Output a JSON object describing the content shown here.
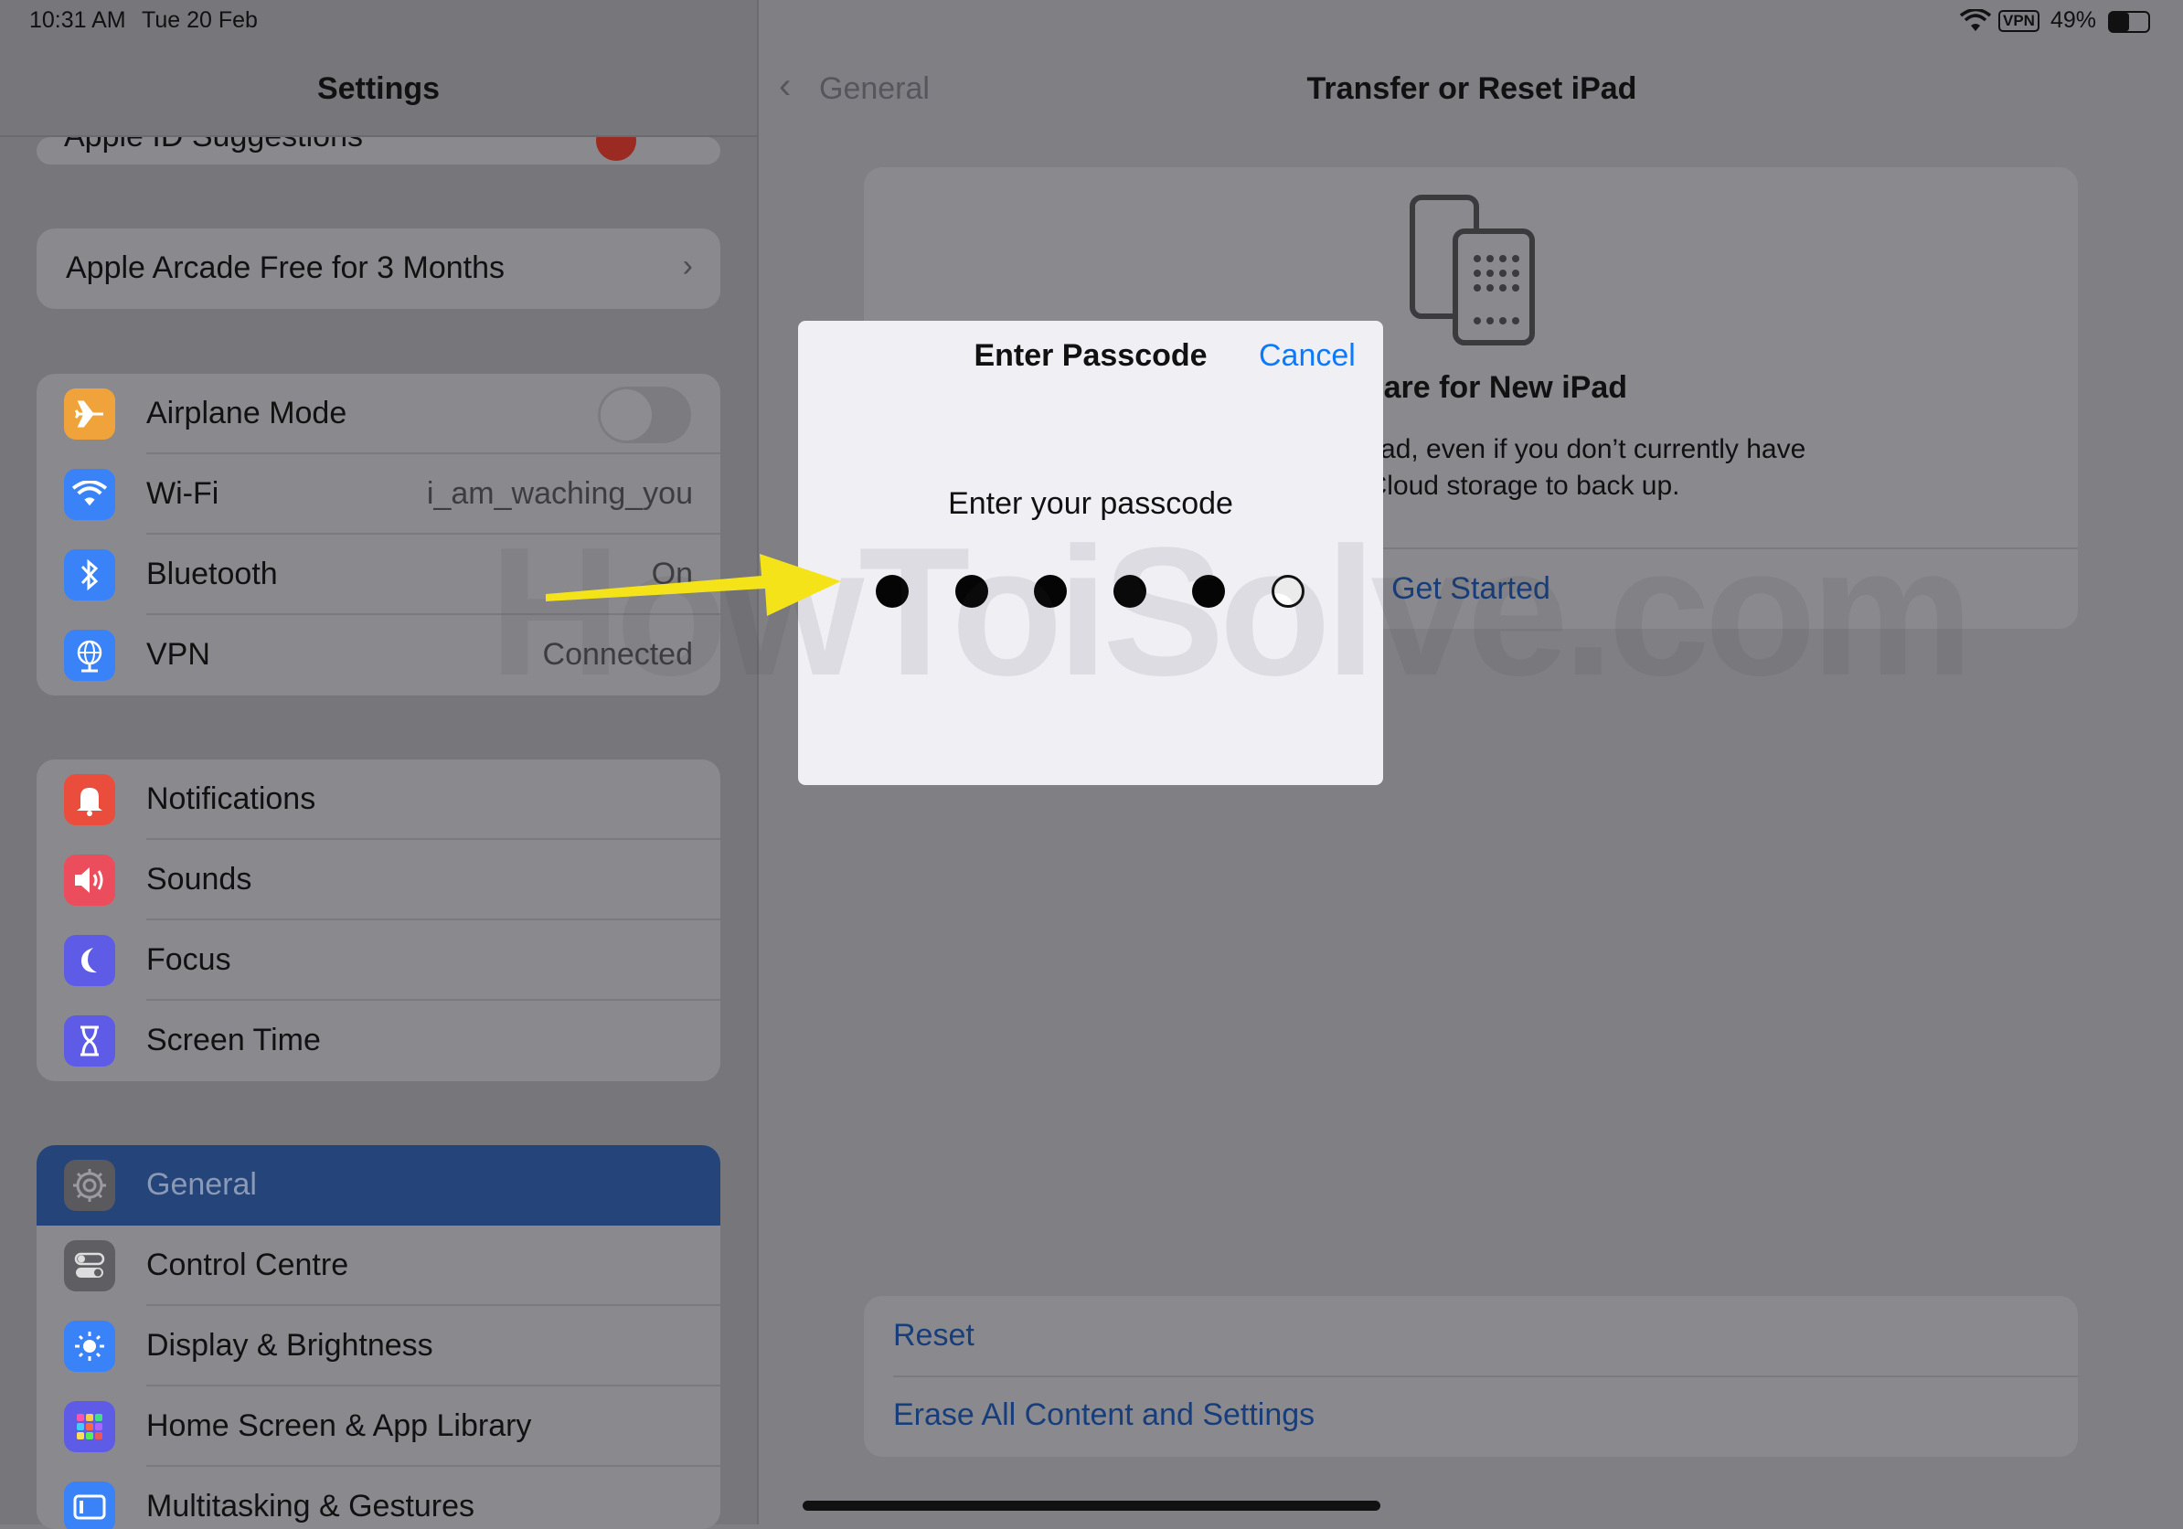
{
  "status_bar": {
    "time": "10:31 AM",
    "date": "Tue 20 Feb",
    "vpn": "VPN",
    "battery": "49%"
  },
  "sidebar": {
    "title": "Settings",
    "partial_top_item": "Apple ID Suggestions",
    "promo": "Apple Arcade Free for 3 Months",
    "connectivity": [
      {
        "label": "Airplane Mode",
        "value": "",
        "icon": "airplane-icon",
        "color": "#f0a33a"
      },
      {
        "label": "Wi-Fi",
        "value": "i_am_waching_you",
        "icon": "wifi-icon",
        "color": "#3a82f7"
      },
      {
        "label": "Bluetooth",
        "value": "On",
        "icon": "bluetooth-icon",
        "color": "#3a82f7"
      },
      {
        "label": "VPN",
        "value": "Connected",
        "icon": "vpn-globe-icon",
        "color": "#3a82f7"
      }
    ],
    "notifications_group": [
      {
        "label": "Notifications",
        "icon": "bell-icon",
        "color": "#eb4d3d"
      },
      {
        "label": "Sounds",
        "icon": "speaker-icon",
        "color": "#eb4d5d"
      },
      {
        "label": "Focus",
        "icon": "moon-icon",
        "color": "#5e5ce6"
      },
      {
        "label": "Screen Time",
        "icon": "hourglass-icon",
        "color": "#5e5ce6"
      }
    ],
    "general_group": [
      {
        "label": "General",
        "icon": "gear-icon",
        "color": "#8e8e93",
        "selected": true
      },
      {
        "label": "Control Centre",
        "icon": "toggles-icon",
        "color": "#8e8e93"
      },
      {
        "label": "Display & Brightness",
        "icon": "sun-icon",
        "color": "#3a82f7"
      },
      {
        "label": "Home Screen & App Library",
        "icon": "app-grid-icon",
        "color": "#5e5ce6"
      },
      {
        "label": "Multitasking & Gestures",
        "icon": "multitasking-icon",
        "color": "#3a82f7"
      }
    ]
  },
  "main": {
    "back_label": "General",
    "title": "Transfer or Reset iPad",
    "prepare_title": "Prepare for New iPad",
    "prepare_desc_line1": "Transfer to a new iPad, even if you don’t currently have",
    "prepare_desc_line2": "enough iCloud storage to back up.",
    "get_started": "Get Started",
    "reset": "Reset",
    "erase": "Erase All Content and Settings"
  },
  "modal": {
    "title": "Enter Passcode",
    "cancel": "Cancel",
    "prompt": "Enter your passcode",
    "digits_total": 6,
    "digits_entered": 5
  },
  "watermark": "HowToiSolve.com",
  "colors": {
    "accent": "#0a7aff",
    "arrow": "#f5e31a",
    "selected_row": "#25457a"
  }
}
